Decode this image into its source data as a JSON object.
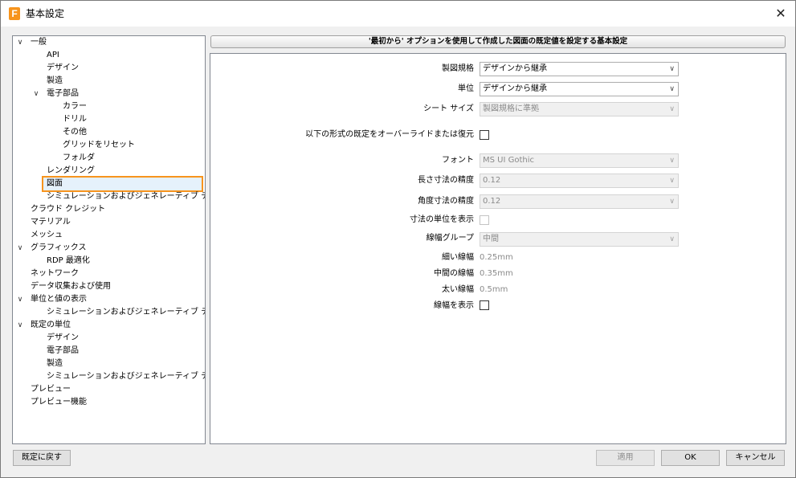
{
  "window": {
    "title": "基本設定",
    "app_icon_letter": "F",
    "close_glyph": "✕"
  },
  "tree": {
    "items": [
      {
        "label": "一般",
        "expanded": true
      },
      {
        "label": "API"
      },
      {
        "label": "デザイン"
      },
      {
        "label": "製造"
      },
      {
        "label": "電子部品",
        "expanded": true
      },
      {
        "label": "カラー"
      },
      {
        "label": "ドリル"
      },
      {
        "label": "その他"
      },
      {
        "label": "グリッドをリセット"
      },
      {
        "label": "フォルダ"
      },
      {
        "label": "レンダリング"
      },
      {
        "label": "図面",
        "selected": true
      },
      {
        "label": "シミュレーションおよびジェネレーティブ デザイン"
      },
      {
        "label": "クラウド クレジット"
      },
      {
        "label": "マテリアル"
      },
      {
        "label": "メッシュ"
      },
      {
        "label": "グラフィックス",
        "expanded": true
      },
      {
        "label": "RDP 最適化"
      },
      {
        "label": "ネットワーク"
      },
      {
        "label": "データ収集および使用"
      },
      {
        "label": "単位と値の表示",
        "expanded": true
      },
      {
        "label": "シミュレーションおよびジェネレーティブ デザイン"
      },
      {
        "label": "既定の単位",
        "expanded": true
      },
      {
        "label": "デザイン"
      },
      {
        "label": "電子部品"
      },
      {
        "label": "製造"
      },
      {
        "label": "シミュレーションおよびジェネレーティブ デザイン"
      },
      {
        "label": "プレビュー"
      },
      {
        "label": "プレビュー機能"
      }
    ]
  },
  "panel": {
    "header": "'最初から' オプションを使用して作成した図面の既定値を設定する基本設定",
    "standard": {
      "label": "製図規格",
      "value": "デザインから継承"
    },
    "units": {
      "label": "単位",
      "value": "デザインから継承"
    },
    "sheet_size": {
      "label": "シート サイズ",
      "value": "製図規格に準拠"
    },
    "override": {
      "label": "以下の形式の既定をオーバーライドまたは復元",
      "checked": false
    },
    "font": {
      "label": "フォント",
      "value": "MS UI Gothic"
    },
    "linear_precision": {
      "label": "長さ寸法の精度",
      "value": "0.12"
    },
    "angular_precision": {
      "label": "角度寸法の精度",
      "value": "0.12"
    },
    "show_units": {
      "label": "寸法の単位を表示",
      "checked": false
    },
    "lineweight_group": {
      "label": "線幅グループ",
      "value": "中間"
    },
    "thin": {
      "label": "細い線幅",
      "value": "0.25mm"
    },
    "medium": {
      "label": "中間の線幅",
      "value": "0.35mm"
    },
    "thick": {
      "label": "太い線幅",
      "value": "0.5mm"
    },
    "show_lineweight": {
      "label": "線幅を表示",
      "checked": false
    }
  },
  "buttons": {
    "restore": "既定に戻す",
    "apply": "適用",
    "ok": "OK",
    "cancel": "キャンセル"
  },
  "colors": {
    "selection_outline": "#f7941d",
    "brand": "#f7941d"
  }
}
